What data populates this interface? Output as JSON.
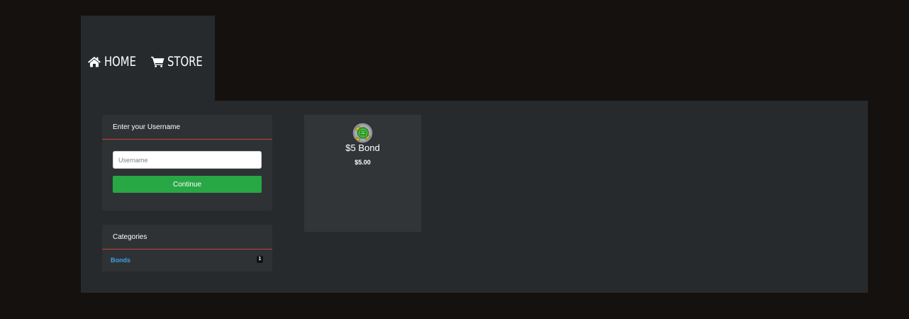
{
  "colors": {
    "page_background": "#15110e",
    "panel_background": "#272a2d",
    "card_background": "#2f3235",
    "accent_red": "#c9403a",
    "button_green": "#28a745",
    "link_blue": "#3aa3e6"
  },
  "nav": {
    "items": [
      {
        "label": "HOME",
        "icon": "home-icon"
      },
      {
        "label": "STORE",
        "icon": "shopping-cart-icon"
      }
    ]
  },
  "sidebar": {
    "username_panel": {
      "title": "Enter your Username",
      "input_placeholder": "Username",
      "input_value": "",
      "button_label": "Continue"
    },
    "categories_panel": {
      "title": "Categories",
      "items": [
        {
          "label": "Bonds",
          "count": "1"
        }
      ]
    }
  },
  "products": [
    {
      "name": "$5 Bond",
      "price": "$5.00",
      "icon": "bond-icon"
    }
  ]
}
